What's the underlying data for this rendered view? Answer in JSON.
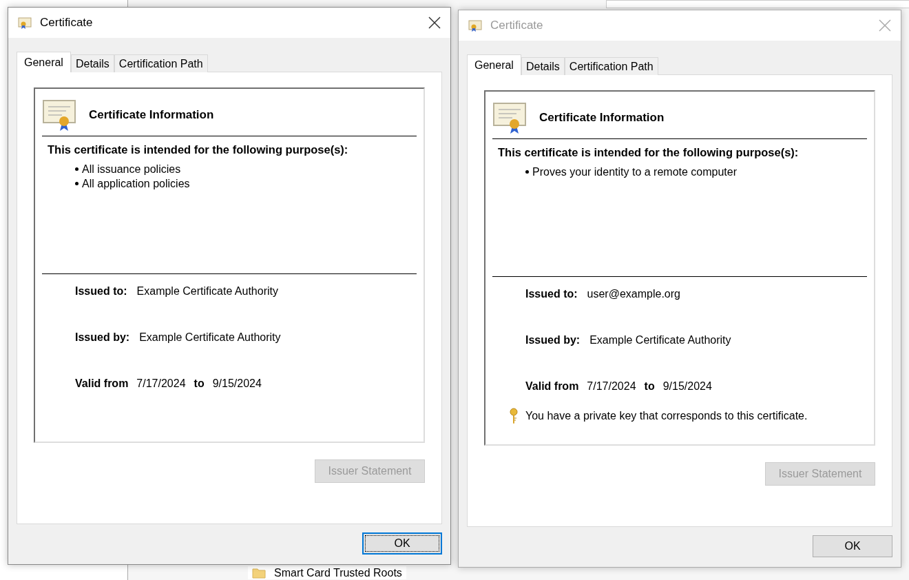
{
  "background": {
    "tree_item": "Smart Card Trusted Roots"
  },
  "dialogs": [
    {
      "title": "Certificate",
      "active": true,
      "tabs": [
        {
          "label": "General",
          "selected": true
        },
        {
          "label": "Details",
          "selected": false
        },
        {
          "label": "Certification Path",
          "selected": false
        }
      ],
      "heading": "Certificate Information",
      "purpose_title": "This certificate is intended for the following purpose(s):",
      "purposes": [
        "All issuance policies",
        "All application policies"
      ],
      "issued_to_label": "Issued to:",
      "issued_to": "Example Certificate Authority",
      "issued_by_label": "Issued by:",
      "issued_by": "Example Certificate Authority",
      "valid_from_label": "Valid from",
      "valid_from": "7/17/2024",
      "to_label": "to",
      "valid_to": "9/15/2024",
      "issuer_button": {
        "label": "Issuer Statement",
        "disabled": true
      },
      "ok_button": {
        "label": "OK",
        "focused": true
      }
    },
    {
      "title": "Certificate",
      "active": false,
      "tabs": [
        {
          "label": "General",
          "selected": true
        },
        {
          "label": "Details",
          "selected": false
        },
        {
          "label": "Certification Path",
          "selected": false
        }
      ],
      "heading": "Certificate Information",
      "purpose_title": "This certificate is intended for the following purpose(s):",
      "purposes": [
        "Proves your identity to a remote computer"
      ],
      "issued_to_label": "Issued to:",
      "issued_to": "user@example.org",
      "issued_by_label": "Issued by:",
      "issued_by": "Example Certificate Authority",
      "valid_from_label": "Valid from",
      "valid_from": "7/17/2024",
      "to_label": "to",
      "valid_to": "9/15/2024",
      "private_key_note": "You have a private key that corresponds to this certificate.",
      "issuer_button": {
        "label": "Issuer Statement",
        "disabled": true
      },
      "ok_button": {
        "label": "OK",
        "focused": false
      }
    }
  ]
}
